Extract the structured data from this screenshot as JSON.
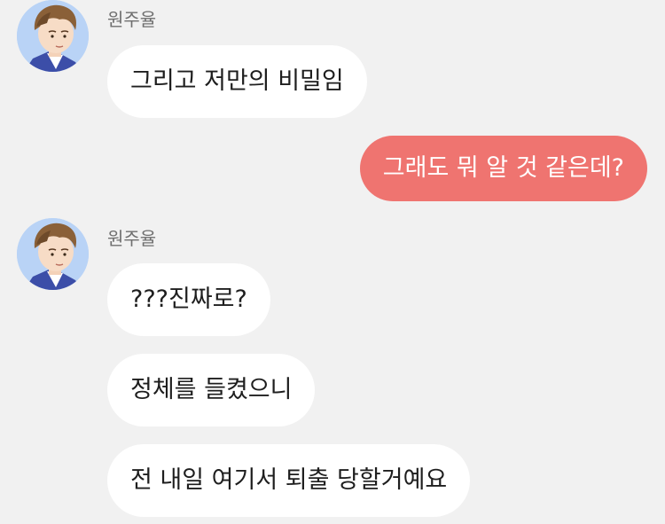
{
  "chat": {
    "groups": [
      {
        "sender": "원주율",
        "messages": [
          "그리고 저만의 비밀임"
        ]
      },
      {
        "self_message": "그래도 뭐 알 것 같은데?"
      },
      {
        "sender": "원주율",
        "messages": [
          "???진짜로?",
          "정체를 들켰으니",
          "전 내일 여기서 퇴출 당할거예요"
        ]
      }
    ]
  },
  "colors": {
    "background": "#f1f1f1",
    "incoming_bubble": "#ffffff",
    "outgoing_bubble": "#ef7470",
    "sender_name": "#6f6f6f"
  },
  "icons": {
    "avatar": "boy-portrait-avatar"
  }
}
